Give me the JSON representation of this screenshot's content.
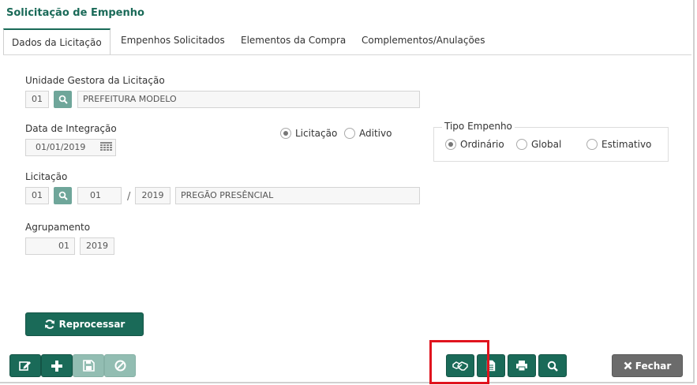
{
  "app": {
    "title": "Solicitação de Empenho"
  },
  "tabs": [
    {
      "label": "Dados da Licitação",
      "active": true
    },
    {
      "label": "Empenhos Solicitados"
    },
    {
      "label": "Elementos da Compra"
    },
    {
      "label": "Complementos/Anulações"
    }
  ],
  "unidade": {
    "label": "Unidade Gestora da Licitação",
    "code": "01",
    "name": "PREFEITURA MODELO"
  },
  "integracao": {
    "label": "Data de Integração",
    "date": "01/01/2019"
  },
  "tipo_origem": {
    "options": [
      {
        "label": "Licitação",
        "selected": true
      },
      {
        "label": "Aditivo",
        "selected": false
      }
    ]
  },
  "tipo_empenho": {
    "legend": "Tipo Empenho",
    "options": [
      {
        "label": "Ordinário",
        "selected": true
      },
      {
        "label": "Global",
        "selected": false
      },
      {
        "label": "Estimativo",
        "selected": false
      }
    ]
  },
  "licitacao": {
    "label": "Licitação",
    "code": "01",
    "number": "01",
    "separator": "/",
    "year": "2019",
    "description": "PREGÃO PRESÊNCIAL"
  },
  "agrupamento": {
    "label": "Agrupamento",
    "number": "01",
    "year": "2019"
  },
  "buttons": {
    "reprocessar": "Reprocessar",
    "fechar": "Fechar"
  },
  "icons": {
    "edit": "edit-icon",
    "add": "plus-icon",
    "save": "save-icon",
    "cancel": "ban-icon",
    "handshake": "handshake-icon",
    "document": "document-icon",
    "print": "print-icon",
    "search": "search-icon",
    "refresh": "refresh-icon",
    "close": "close-icon"
  },
  "colors": {
    "primary": "#1a6a58",
    "primary_light": "#92bdb2",
    "search_button": "#6fa69a",
    "close_button": "#6b6b6b",
    "highlight": "#e0141e"
  }
}
